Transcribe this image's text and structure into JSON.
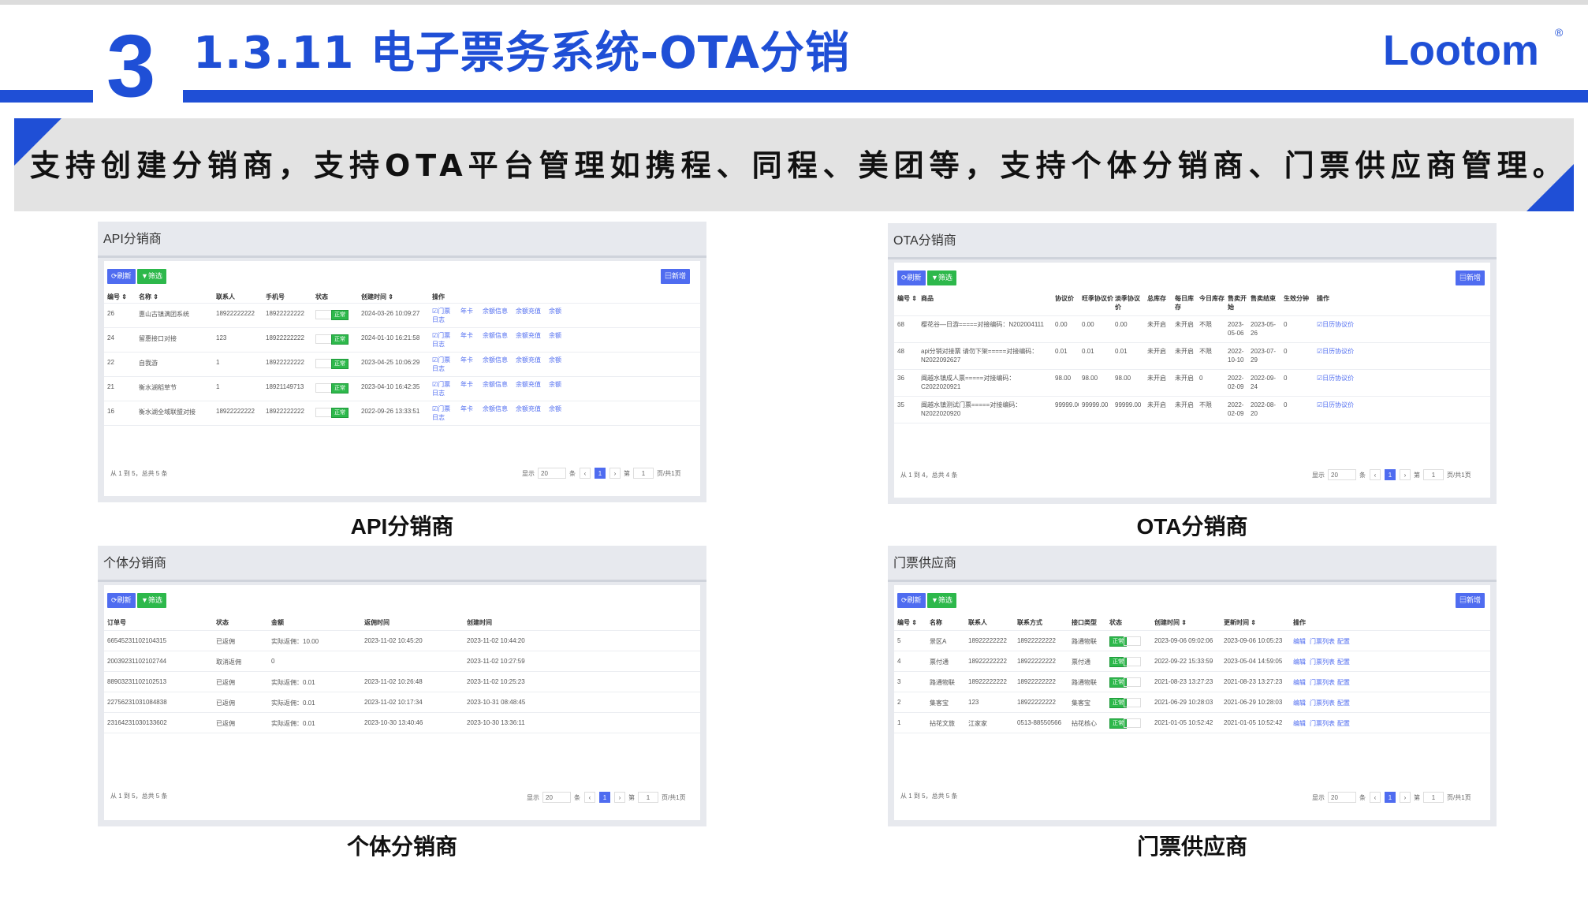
{
  "header": {
    "section_number": "3",
    "title": "1.3.11 电子票务系统-OTA分销",
    "logo_text": "Lootom",
    "logo_mark": "®",
    "accent_color": "#1f4fd6"
  },
  "banner": {
    "text": "支持创建分销商，支持OTA平台管理如携程、同程、美团等，支持个体分销商、门票供应商管理。"
  },
  "panels": {
    "api": {
      "title": "API分销商",
      "caption": "API分销商",
      "refresh_label": "⟳刷新",
      "filter_label": "▼筛选",
      "add_label": "▤新增",
      "headers": [
        "编号 ⇕",
        "名称 ⇕",
        "联系人",
        "手机号",
        "状态",
        "创建时间 ⇕",
        "操作"
      ],
      "rows": [
        {
          "id": "26",
          "name": "惠山古镇满团系统",
          "contact": "18922222222",
          "phone": "18922222222",
          "status": "正常",
          "created": "2024-03-26 10:09:27"
        },
        {
          "id": "24",
          "name": "留惠接口对接",
          "contact": "123",
          "phone": "18922222222",
          "status": "正常",
          "created": "2024-01-10 16:21:58"
        },
        {
          "id": "22",
          "name": "自我游",
          "contact": "1",
          "phone": "18922222222",
          "status": "正常",
          "created": "2023-04-25 10:06:29"
        },
        {
          "id": "21",
          "name": "衡水湖稻草节",
          "contact": "1",
          "phone": "18921149713",
          "status": "正常",
          "created": "2023-04-10 16:42:35"
        },
        {
          "id": "16",
          "name": "衡水湖全域联盟对接",
          "contact": "18922222222",
          "phone": "18922222222",
          "status": "正常",
          "created": "2022-09-26 13:33:51"
        }
      ],
      "actions": [
        "☑门票",
        "年卡",
        "余额信息",
        "余额充值",
        "余额"
      ],
      "action_log": "日志",
      "footer": "从 1 到 5，总共 5 条",
      "pager": {
        "show": "显示",
        "size": "20",
        "unit": "条",
        "prev": "‹",
        "page": "1",
        "next": "›",
        "goto": "第",
        "goto_val": "1",
        "total": "页/共1页"
      }
    },
    "ota": {
      "title": "OTA分销商",
      "caption": "OTA分销商",
      "refresh_label": "⟳刷新",
      "filter_label": "▼筛选",
      "add_label": "▤新增",
      "headers": [
        "编号 ⇕",
        "商品",
        "协议价",
        "旺季协议价",
        "淡季协议价",
        "总库存",
        "每日库存",
        "今日库存",
        "售卖开始",
        "售卖结束",
        "生效分钟",
        "操作"
      ],
      "rows": [
        {
          "id": "68",
          "product": "樱花谷—日游=====对接编码：N202004111",
          "price": "0.00",
          "peak": "0.00",
          "low": "0.00",
          "total": "未开启",
          "daily": "未开启",
          "today": "不限",
          "start": "2023-05-06",
          "end": "2023-05-26",
          "min": "0",
          "action": "☑日历协议价"
        },
        {
          "id": "48",
          "product": "api分销对接票 请勿下架=====对接编码：N2022092627",
          "price": "0.01",
          "peak": "0.01",
          "low": "0.01",
          "total": "未开启",
          "daily": "未开启",
          "today": "不限",
          "start": "2022-10-10",
          "end": "2023-07-29",
          "min": "0",
          "action": "☑日历协议价"
        },
        {
          "id": "36",
          "product": "闽越水镇成人票=====对接编码：C2022020921",
          "price": "98.00",
          "peak": "98.00",
          "low": "98.00",
          "total": "未开启",
          "daily": "未开启",
          "today": "0",
          "start": "2022-02-09",
          "end": "2022-09-24",
          "min": "0",
          "action": "☑日历协议价"
        },
        {
          "id": "35",
          "product": "闽越水镇测试门票=====对接编码：N2022020920",
          "price": "99999.00",
          "peak": "99999.00",
          "low": "99999.00",
          "total": "未开启",
          "daily": "未开启",
          "today": "不限",
          "start": "2022-02-09",
          "end": "2022-08-20",
          "min": "0",
          "action": "☑日历协议价"
        }
      ],
      "footer": "从 1 到 4，总共 4 条",
      "pager": {
        "show": "显示",
        "size": "20",
        "unit": "条",
        "prev": "‹",
        "page": "1",
        "next": "›",
        "goto": "第",
        "goto_val": "1",
        "total": "页/共1页"
      }
    },
    "individual": {
      "title": "个体分销商",
      "caption": "个体分销商",
      "refresh_label": "⟳刷新",
      "filter_label": "▼筛选",
      "headers": [
        "订单号",
        "状态",
        "金额",
        "返佣时间",
        "创建时间"
      ],
      "rows": [
        {
          "order": "66545231102104315",
          "status": "已返佣",
          "amount": "实际返佣：10.00",
          "rebate": "2023-11-02 10:45:20",
          "created": "2023-11-02 10:44:20"
        },
        {
          "order": "20039231102102744",
          "status": "取消返佣",
          "amount": "0",
          "rebate": "",
          "created": "2023-11-02 10:27:59"
        },
        {
          "order": "88903231102102513",
          "status": "已返佣",
          "amount": "实际返佣：0.01",
          "rebate": "2023-11-02 10:26:48",
          "created": "2023-11-02 10:25:23"
        },
        {
          "order": "22756231031084838",
          "status": "已返佣",
          "amount": "实际返佣：0.01",
          "rebate": "2023-11-02 10:17:34",
          "created": "2023-10-31 08:48:45"
        },
        {
          "order": "23164231030133602",
          "status": "已返佣",
          "amount": "实际返佣：0.01",
          "rebate": "2023-10-30 13:40:46",
          "created": "2023-10-30 13:36:11"
        }
      ],
      "footer": "从 1 到 5，总共 5 条",
      "pager": {
        "show": "显示",
        "size": "20",
        "unit": "条",
        "prev": "‹",
        "page": "1",
        "next": "›",
        "goto": "第",
        "goto_val": "1",
        "total": "页/共1页"
      }
    },
    "supplier": {
      "title": "门票供应商",
      "caption": "门票供应商",
      "refresh_label": "⟳刷新",
      "filter_label": "▼筛选",
      "add_label": "▤新增",
      "headers": [
        "编号 ⇕",
        "名称",
        "联系人",
        "联系方式",
        "接口类型",
        "状态",
        "创建时间 ⇕",
        "更新时间 ⇕",
        "操作"
      ],
      "rows": [
        {
          "id": "5",
          "name": "景区A",
          "contact": "18922222222",
          "phone": "18922222222",
          "type": "路通物联",
          "status": "正常",
          "created": "2023-09-06 09:02:06",
          "updated": "2023-09-06 10:05:23"
        },
        {
          "id": "4",
          "name": "票付通",
          "contact": "18922222222",
          "phone": "18922222222",
          "type": "票付通",
          "status": "正常",
          "created": "2022-09-22 15:33:59",
          "updated": "2023-05-04 14:59:05"
        },
        {
          "id": "3",
          "name": "路通物联",
          "contact": "18922222222",
          "phone": "18922222222",
          "type": "路通物联",
          "status": "正常",
          "created": "2021-08-23 13:27:23",
          "updated": "2021-08-23 13:27:23"
        },
        {
          "id": "2",
          "name": "集客宝",
          "contact": "123",
          "phone": "18922222222",
          "type": "集客宝",
          "status": "正常",
          "created": "2021-06-29 10:28:03",
          "updated": "2021-06-29 10:28:03"
        },
        {
          "id": "1",
          "name": "拈花文旅",
          "contact": "江家家",
          "phone": "0513-88550566",
          "type": "拈花核心",
          "status": "正常",
          "created": "2021-01-05 10:52:42",
          "updated": "2021-01-05 10:52:42"
        }
      ],
      "actions": [
        "编辑",
        "门票列表",
        "配置"
      ],
      "footer": "从 1 到 5，总共 5 条",
      "pager": {
        "show": "显示",
        "size": "20",
        "unit": "条",
        "prev": "‹",
        "page": "1",
        "next": "›",
        "goto": "第",
        "goto_val": "1",
        "total": "页/共1页"
      }
    }
  }
}
